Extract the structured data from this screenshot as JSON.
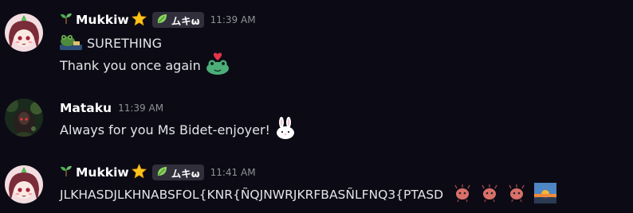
{
  "messages": [
    {
      "author": "Mukkiw",
      "role_tag": "ムキω",
      "time": "11:39 AM",
      "lines": [
        "SURETHING",
        "Thank you once again"
      ]
    },
    {
      "author": "Mataku",
      "time": "11:39 AM",
      "lines": [
        "Always for you Ms Bidet-enjoyer!"
      ]
    },
    {
      "author": "Mukkiw",
      "role_tag": "ムキω",
      "time": "11:41 AM",
      "lines": [
        "JLKHASDJLKHNABSFOL{KNR{ÑQJNWRJKRFBASÑLFNQ3{PTASD"
      ]
    }
  ],
  "icons": {
    "name_prefix": "sprout-icon",
    "name_suffix": "star-icon",
    "tag_icon": "leaf-icon"
  },
  "colors": {
    "background": "#0c0b15",
    "author_name": "#ffffff",
    "timestamp": "#8e9297",
    "tag_bg": "#302f3b"
  }
}
